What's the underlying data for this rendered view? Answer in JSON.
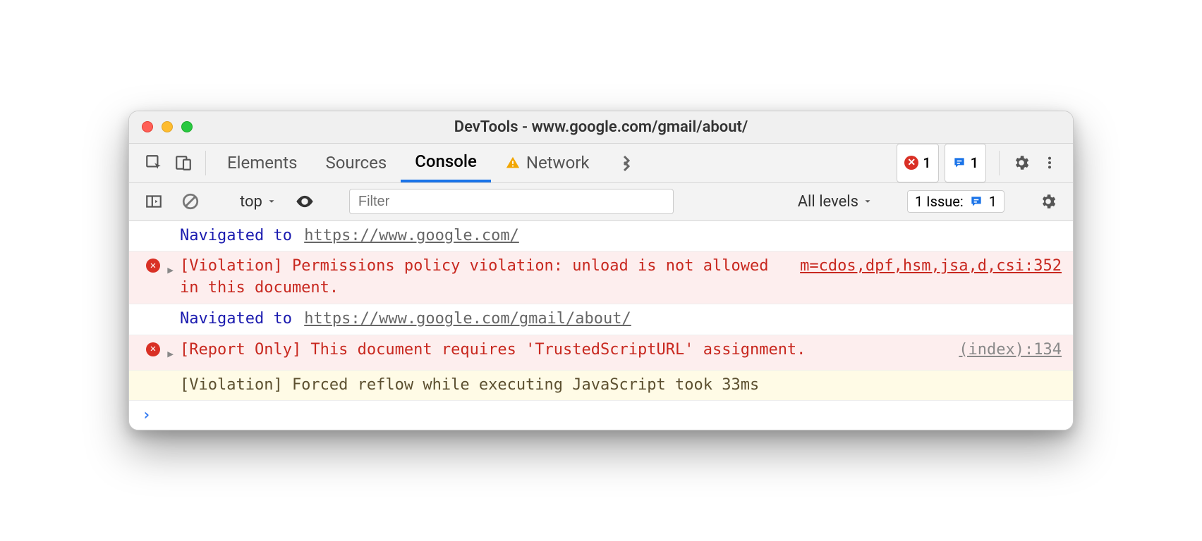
{
  "window": {
    "title": "DevTools - www.google.com/gmail/about/"
  },
  "tabs": {
    "elements": "Elements",
    "sources": "Sources",
    "console": "Console",
    "network": "Network"
  },
  "badges": {
    "error_count": "1",
    "issue_count": "1"
  },
  "console_toolbar": {
    "context": "top",
    "filter_placeholder": "Filter",
    "levels": "All levels",
    "issue_label": "1 Issue:",
    "issue_num": "1"
  },
  "log": {
    "nav1_prefix": "Navigated to ",
    "nav1_url": "https://www.google.com/",
    "err1_msg": "[Violation] Permissions policy violation: unload is not allowed in this document.",
    "err1_src": "m=cdos,dpf,hsm,jsa,d,csi:352",
    "nav2_prefix": "Navigated to ",
    "nav2_url": "https://www.google.com/gmail/about/",
    "err2_msg": "[Report Only] This document requires 'TrustedScriptURL' assignment.",
    "err2_src": "(index):134",
    "warn_msg": "[Violation] Forced reflow while executing JavaScript took 33ms"
  }
}
